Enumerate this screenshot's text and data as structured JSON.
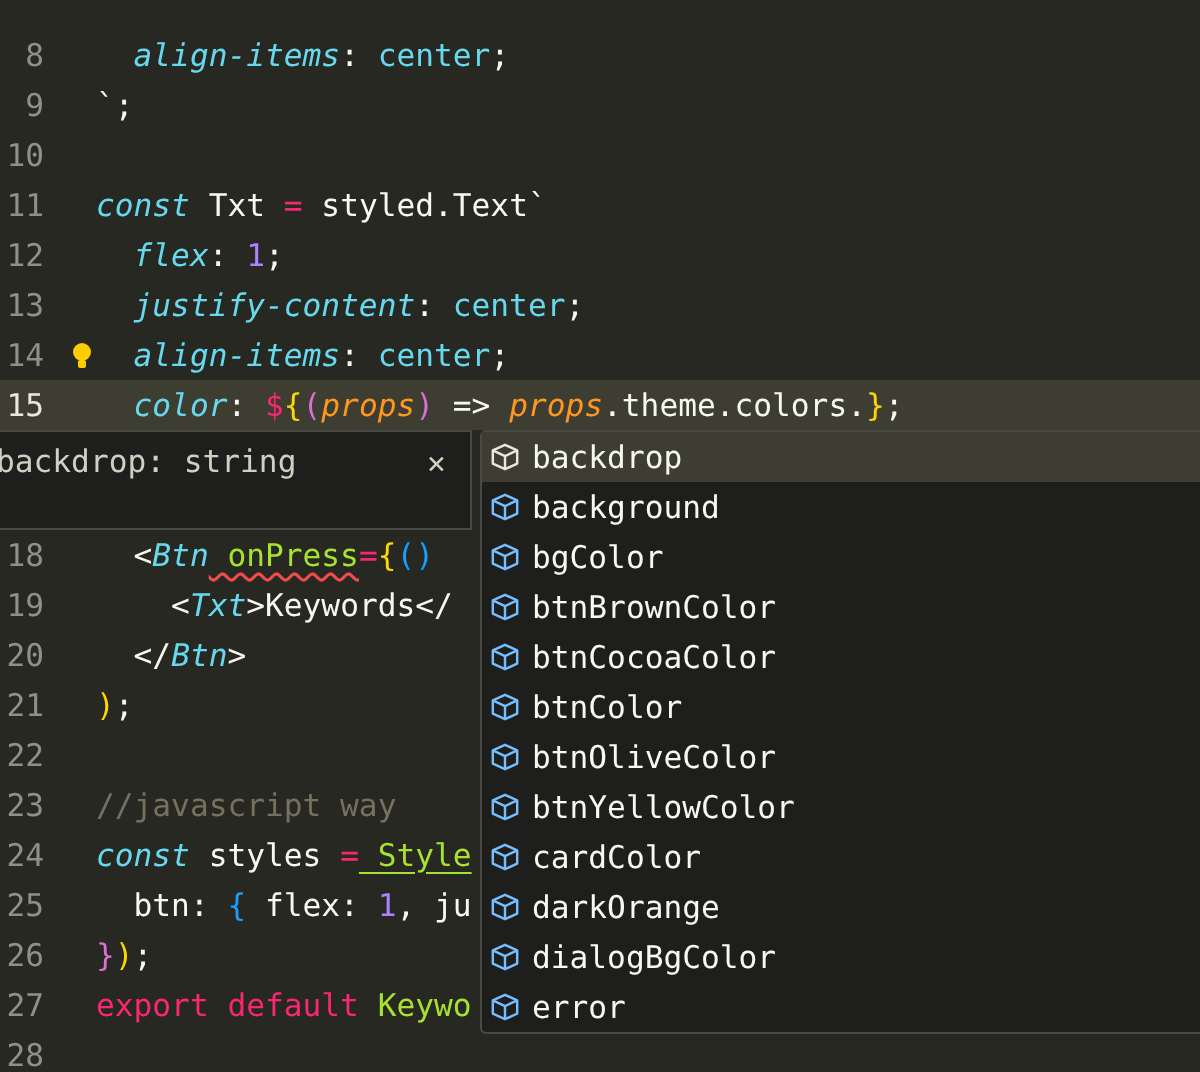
{
  "editor": {
    "lines_above": [
      {
        "number": "8",
        "current": false,
        "lightbulb": false,
        "tokens": [
          {
            "kind": "prop",
            "text": "  align-items"
          },
          {
            "kind": "plain",
            "text": ": "
          },
          {
            "kind": "val",
            "text": "center"
          },
          {
            "kind": "plain",
            "text": ";"
          }
        ]
      },
      {
        "number": "9",
        "current": false,
        "lightbulb": false,
        "tokens": [
          {
            "kind": "plain",
            "text": "`;"
          }
        ]
      },
      {
        "number": "10",
        "current": false,
        "lightbulb": false
      },
      {
        "number": "11",
        "current": false,
        "lightbulb": false,
        "tokens": [
          {
            "kind": "kw",
            "text": "const"
          },
          {
            "kind": "plain",
            "text": " Txt "
          },
          {
            "kind": "op",
            "text": "="
          },
          {
            "kind": "plain",
            "text": " styled.Text`"
          }
        ]
      },
      {
        "number": "12",
        "current": false,
        "lightbulb": false,
        "tokens": [
          {
            "kind": "prop",
            "text": "  flex"
          },
          {
            "kind": "plain",
            "text": ": "
          },
          {
            "kind": "num",
            "text": "1"
          },
          {
            "kind": "plain",
            "text": ";"
          }
        ]
      },
      {
        "number": "13",
        "current": false,
        "lightbulb": false,
        "tokens": [
          {
            "kind": "prop",
            "text": "  justify-content"
          },
          {
            "kind": "plain",
            "text": ": "
          },
          {
            "kind": "val",
            "text": "center"
          },
          {
            "kind": "plain",
            "text": ";"
          }
        ]
      },
      {
        "number": "14",
        "current": false,
        "lightbulb": true,
        "tokens": [
          {
            "kind": "prop",
            "text": "  align-items"
          },
          {
            "kind": "plain",
            "text": ": "
          },
          {
            "kind": "val",
            "text": "center"
          },
          {
            "kind": "plain",
            "text": ";"
          }
        ]
      },
      {
        "number": "15",
        "current": true,
        "lightbulb": false,
        "tokens": [
          {
            "kind": "prop",
            "text": "  color"
          },
          {
            "kind": "plain",
            "text": ": "
          },
          {
            "kind": "op",
            "text": "$"
          },
          {
            "kind": "bracket1",
            "text": "{"
          },
          {
            "kind": "bracket2",
            "text": "("
          },
          {
            "kind": "param",
            "text": "props"
          },
          {
            "kind": "bracket2",
            "text": ")"
          },
          {
            "kind": "plain",
            "text": " => "
          },
          {
            "kind": "param",
            "text": "props"
          },
          {
            "kind": "plain",
            "text": ".theme.colors."
          },
          {
            "kind": "bracket1",
            "text": "}"
          },
          {
            "kind": "plain",
            "text": ";"
          }
        ]
      }
    ],
    "hover": {
      "text": "backdrop: string",
      "close": "×"
    },
    "lines_below": [
      {
        "number": "18",
        "current": false,
        "lightbulb": false,
        "tokens": [
          {
            "kind": "plain",
            "text": "  <"
          },
          {
            "kind": "tag",
            "text": "Btn"
          },
          {
            "kind": "fn",
            "text": " onPress",
            "error": true
          },
          {
            "kind": "op",
            "text": "="
          },
          {
            "kind": "bracket1",
            "text": "{"
          },
          {
            "kind": "bracket3",
            "text": "()"
          }
        ]
      },
      {
        "number": "19",
        "current": false,
        "lightbulb": false,
        "tokens": [
          {
            "kind": "plain",
            "text": "    <"
          },
          {
            "kind": "tag",
            "text": "Txt"
          },
          {
            "kind": "plain",
            "text": ">Keywords</"
          }
        ]
      },
      {
        "number": "20",
        "current": false,
        "lightbulb": false,
        "tokens": [
          {
            "kind": "plain",
            "text": "  </"
          },
          {
            "kind": "tag",
            "text": "Btn"
          },
          {
            "kind": "plain",
            "text": ">"
          }
        ]
      },
      {
        "number": "21",
        "current": false,
        "lightbulb": false,
        "tokens": [
          {
            "kind": "bracket1",
            "text": ")"
          },
          {
            "kind": "plain",
            "text": ";"
          }
        ]
      },
      {
        "number": "22",
        "current": false,
        "lightbulb": false
      },
      {
        "number": "23",
        "current": false,
        "lightbulb": false,
        "tokens": [
          {
            "kind": "comment",
            "text": "//javascript way"
          }
        ]
      },
      {
        "number": "24",
        "current": false,
        "lightbulb": false,
        "tokens": [
          {
            "kind": "kw",
            "text": "const"
          },
          {
            "kind": "plain",
            "text": " styles "
          },
          {
            "kind": "op",
            "text": "="
          },
          {
            "kind": "fn",
            "text": " Style",
            "warning": true
          }
        ]
      },
      {
        "number": "25",
        "current": false,
        "lightbulb": false,
        "tokens": [
          {
            "kind": "plain",
            "text": "  btn: "
          },
          {
            "kind": "bracket3",
            "text": "{"
          },
          {
            "kind": "plain",
            "text": " flex: "
          },
          {
            "kind": "num",
            "text": "1"
          },
          {
            "kind": "plain",
            "text": ", ju"
          }
        ]
      },
      {
        "number": "26",
        "current": false,
        "lightbulb": false,
        "tokens": [
          {
            "kind": "bracket2",
            "text": "}"
          },
          {
            "kind": "bracket1",
            "text": ")"
          },
          {
            "kind": "plain",
            "text": ";"
          }
        ]
      },
      {
        "number": "27",
        "current": false,
        "lightbulb": false,
        "tokens": [
          {
            "kind": "op",
            "text": "export default"
          },
          {
            "kind": "fn",
            "text": " Keywo"
          }
        ]
      },
      {
        "number": "28",
        "current": false,
        "lightbulb": false
      }
    ]
  },
  "suggestions": [
    {
      "label": "backdrop",
      "selected": true
    },
    {
      "label": "background",
      "selected": false
    },
    {
      "label": "bgColor",
      "selected": false
    },
    {
      "label": "btnBrownColor",
      "selected": false
    },
    {
      "label": "btnCocoaColor",
      "selected": false
    },
    {
      "label": "btnColor",
      "selected": false
    },
    {
      "label": "btnOliveColor",
      "selected": false
    },
    {
      "label": "btnYellowColor",
      "selected": false
    },
    {
      "label": "cardColor",
      "selected": false
    },
    {
      "label": "darkOrange",
      "selected": false
    },
    {
      "label": "dialogBgColor",
      "selected": false
    },
    {
      "label": "error",
      "selected": false
    }
  ]
}
